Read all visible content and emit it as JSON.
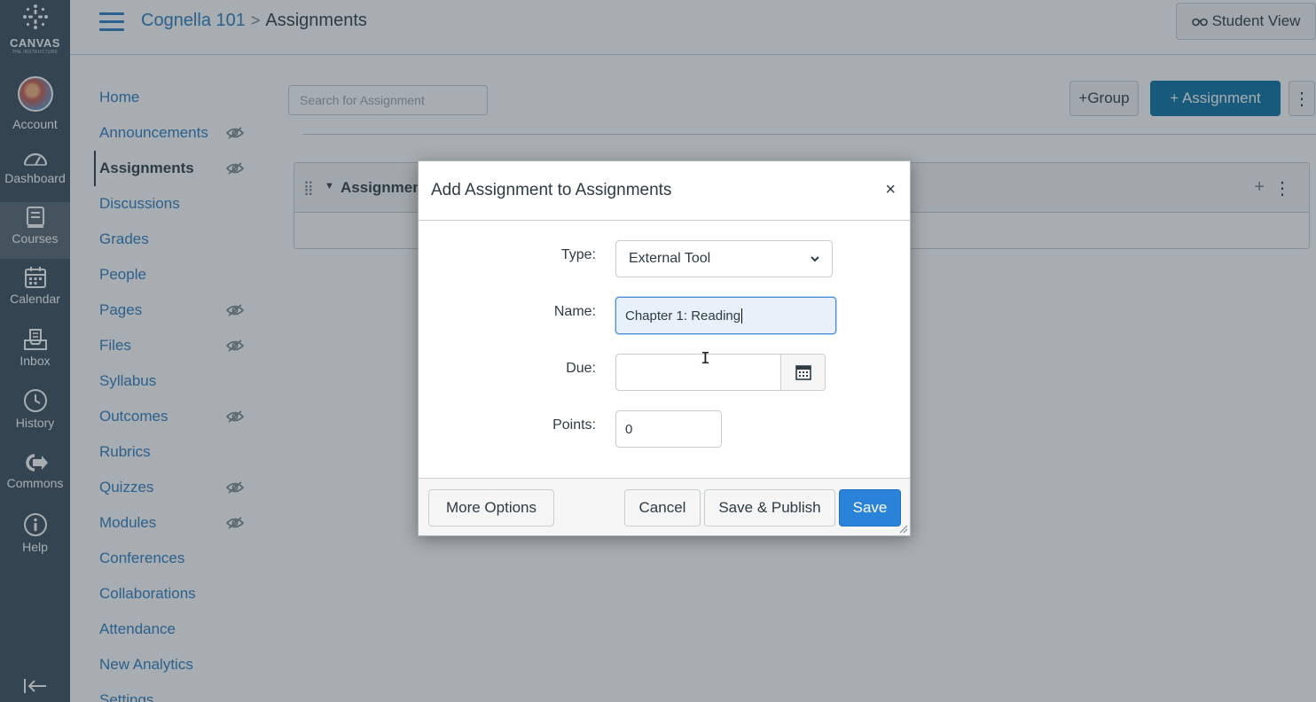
{
  "global_nav": {
    "logo_word": "CANVAS",
    "logo_sub": "THE INSTRUCTURE",
    "items": [
      {
        "label": "Account",
        "icon": "avatar"
      },
      {
        "label": "Dashboard",
        "icon": "dashboard-icon"
      },
      {
        "label": "Courses",
        "icon": "courses-icon"
      },
      {
        "label": "Calendar",
        "icon": "calendar-icon"
      },
      {
        "label": "Inbox",
        "icon": "inbox-icon"
      },
      {
        "label": "History",
        "icon": "history-icon"
      },
      {
        "label": "Commons",
        "icon": "commons-icon"
      },
      {
        "label": "Help",
        "icon": "help-icon"
      }
    ]
  },
  "header": {
    "course": "Cognella 101",
    "separator": ">",
    "current": "Assignments",
    "student_view": "Student View",
    "student_view_icon": "glasses-icon"
  },
  "course_nav": [
    {
      "label": "Home",
      "hidden_eye": false
    },
    {
      "label": "Announcements",
      "hidden_eye": true
    },
    {
      "label": "Assignments",
      "hidden_eye": true,
      "active": true
    },
    {
      "label": "Discussions",
      "hidden_eye": false
    },
    {
      "label": "Grades",
      "hidden_eye": false
    },
    {
      "label": "People",
      "hidden_eye": false
    },
    {
      "label": "Pages",
      "hidden_eye": true
    },
    {
      "label": "Files",
      "hidden_eye": true
    },
    {
      "label": "Syllabus",
      "hidden_eye": false
    },
    {
      "label": "Outcomes",
      "hidden_eye": true
    },
    {
      "label": "Rubrics",
      "hidden_eye": false
    },
    {
      "label": "Quizzes",
      "hidden_eye": true
    },
    {
      "label": "Modules",
      "hidden_eye": true
    },
    {
      "label": "Conferences",
      "hidden_eye": false
    },
    {
      "label": "Collaborations",
      "hidden_eye": false
    },
    {
      "label": "Attendance",
      "hidden_eye": false
    },
    {
      "label": "New Analytics",
      "hidden_eye": false
    },
    {
      "label": "Settings",
      "hidden_eye": false
    }
  ],
  "toolbar": {
    "search_placeholder": "Search for Assignment",
    "group_button": "+Group",
    "assignment_button": "+ Assignment",
    "kebab": "⋮"
  },
  "assignment_group": {
    "title": "Assignments"
  },
  "dialog": {
    "title": "Add Assignment to Assignments",
    "close": "×",
    "type_label": "Type:",
    "type_value": "External Tool",
    "name_label": "Name:",
    "name_value": "Chapter 1: Reading",
    "due_label": "Due:",
    "due_value": "",
    "points_label": "Points:",
    "points_value": "0",
    "buttons": {
      "more_options": "More Options",
      "cancel": "Cancel",
      "save_publish": "Save & Publish",
      "save": "Save"
    }
  },
  "colors": {
    "nav_bg": "#394b58",
    "link": "#2d7abf",
    "primary": "#2b82d9"
  }
}
